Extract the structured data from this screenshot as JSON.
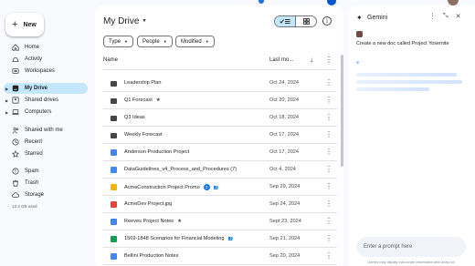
{
  "sidebar": {
    "new_label": "New",
    "items": [
      {
        "label": "Home",
        "icon": "home-icon"
      },
      {
        "label": "Activity",
        "icon": "activity-icon"
      },
      {
        "label": "Workspaces",
        "icon": "workspaces-icon"
      },
      {
        "label": "My Drive",
        "icon": "drive-icon",
        "active": true
      },
      {
        "label": "Shared drives",
        "icon": "shared-drives-icon"
      },
      {
        "label": "Computers",
        "icon": "computer-icon"
      },
      {
        "label": "Shared with me",
        "icon": "people-icon"
      },
      {
        "label": "Recent",
        "icon": "clock-icon"
      },
      {
        "label": "Starred",
        "icon": "star-icon"
      },
      {
        "label": "Spam",
        "icon": "spam-icon"
      },
      {
        "label": "Trash",
        "icon": "trash-icon"
      },
      {
        "label": "Storage",
        "icon": "cloud-icon"
      }
    ],
    "storage_text": "12.3 GB used"
  },
  "main": {
    "title": "My Drive",
    "filters": [
      "Type",
      "People",
      "Modified"
    ],
    "columns": {
      "name": "Name",
      "modified": "Last mo..."
    },
    "files": [
      {
        "name": "Leadership Plan",
        "type": "folder",
        "date": "Oct 24, 2024"
      },
      {
        "name": "Q1 Forecast",
        "type": "folder-red",
        "date": "Oct 20, 2024",
        "starred": true
      },
      {
        "name": "Q3 Ideas",
        "type": "folder",
        "date": "Oct 18, 2024"
      },
      {
        "name": "Weekly Forecast",
        "type": "folder-shared",
        "date": "Oct 17, 2024"
      },
      {
        "name": "Anderson Production Project",
        "type": "doc",
        "date": "Oct 17, 2024"
      },
      {
        "name": "DataGuidelines_v4_Process_and_Procedures (7)",
        "type": "doc",
        "date": "Oct 4, 2024"
      },
      {
        "name": "AcmeConstruction Project Promo",
        "type": "slides",
        "date": "Sep 29, 2024",
        "badge": "2",
        "shared": true
      },
      {
        "name": "AcmeDev Project.jpg",
        "type": "image",
        "date": "Sep 24, 2024"
      },
      {
        "name": "Reeves Project Notes",
        "type": "doc",
        "date": "Sept 23, 2024",
        "starred": true
      },
      {
        "name": "1569-1848 Scenarios for Financial Modeling",
        "type": "sheet",
        "date": "Sep 21, 2024",
        "shared": true
      },
      {
        "name": "Bellini Production Notes",
        "type": "doc",
        "date": "Sep 20, 2024"
      }
    ]
  },
  "gemini": {
    "title": "Gemini",
    "user_prompt": "Create a new doc called Project Yosemite",
    "input_placeholder": "Enter a prompt here",
    "disclaimer": "Gemini may display inaccurate information and ideas not"
  },
  "icons": {
    "star": "★",
    "more": "⋮",
    "sort": "↓",
    "shared": "👥"
  },
  "colors": {
    "accent": "#0b57d0",
    "active_nav": "#c2e7ff",
    "folder": "#444746",
    "doc": "#4285f4",
    "sheet": "#0f9d58",
    "slides": "#f4b400",
    "image": "#ea4335"
  }
}
